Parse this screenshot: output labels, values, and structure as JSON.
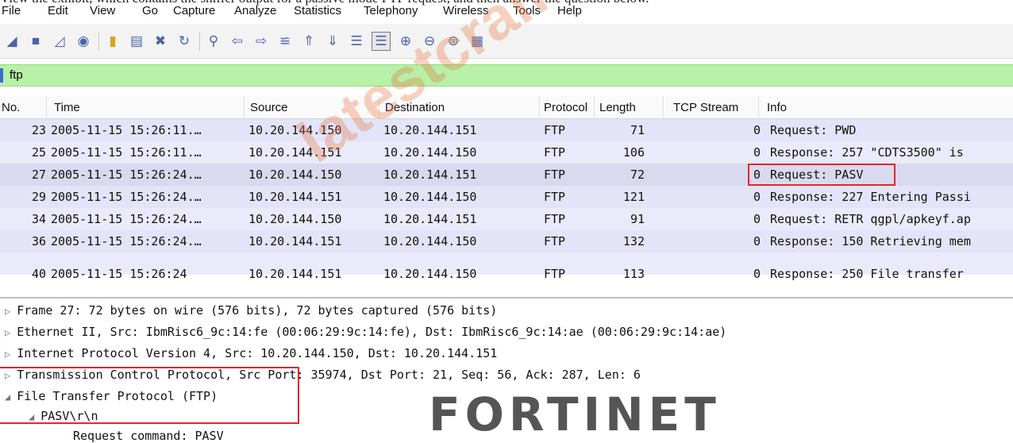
{
  "caption": "View the exhibit, which contains the sniffer output for a passive mode FTP request, and then answer the question below.",
  "menu": [
    "File",
    "Edit",
    "View",
    "Go",
    "Capture",
    "Analyze",
    "Statistics",
    "Telephony",
    "Wireless",
    "Tools",
    "Help"
  ],
  "toolbar_icons": [
    "shark-fin-start-icon",
    "stop-icon",
    "restart-icon",
    "options-gear-icon",
    "open-folder-icon",
    "save-file-icon",
    "close-file-icon",
    "reload-icon",
    "find-packet-icon",
    "go-back-icon",
    "go-forward-icon",
    "go-to-packet-icon",
    "first-packet-icon",
    "last-packet-icon",
    "autoscroll-icon",
    "colorize-icon",
    "zoom-in-icon",
    "zoom-out-icon",
    "normal-size-icon",
    "resize-columns-icon"
  ],
  "filter": {
    "value": "ftp"
  },
  "columns": [
    "No.",
    "Time",
    "Source",
    "Destination",
    "Protocol",
    "Length",
    "TCP Stream",
    "Info"
  ],
  "rows": [
    {
      "no": "23",
      "time": "2005-11-15 15:26:11.…",
      "src": "10.20.144.150",
      "dst": "10.20.144.151",
      "proto": "FTP",
      "len": "71",
      "stream": "0",
      "info": "Request: PWD"
    },
    {
      "no": "25",
      "time": "2005-11-15 15:26:11.…",
      "src": "10.20.144.151",
      "dst": "10.20.144.150",
      "proto": "FTP",
      "len": "106",
      "stream": "0",
      "info": "Response: 257 \"CDTS3500\" is"
    },
    {
      "no": "27",
      "time": "2005-11-15 15:26:24.…",
      "src": "10.20.144.150",
      "dst": "10.20.144.151",
      "proto": "FTP",
      "len": "72",
      "stream": "0",
      "info": "Request: PASV"
    },
    {
      "no": "29",
      "time": "2005-11-15 15:26:24.…",
      "src": "10.20.144.151",
      "dst": "10.20.144.150",
      "proto": "FTP",
      "len": "121",
      "stream": "0",
      "info": "Response: 227 Entering Passi"
    },
    {
      "no": "34",
      "time": "2005-11-15 15:26:24.…",
      "src": "10.20.144.150",
      "dst": "10.20.144.151",
      "proto": "FTP",
      "len": "91",
      "stream": "0",
      "info": "Request: RETR qgpl/apkeyf.ap"
    },
    {
      "no": "36",
      "time": "2005-11-15 15:26:24.…",
      "src": "10.20.144.151",
      "dst": "10.20.144.150",
      "proto": "FTP",
      "len": "132",
      "stream": "0",
      "info": "Response: 150 Retrieving mem"
    },
    {
      "no": "40",
      "time": "2005-11-15 15:26:24",
      "src": "10.20.144.151",
      "dst": "10.20.144.150",
      "proto": "FTP",
      "len": "113",
      "stream": "0",
      "info": "Response: 250 File transfer"
    }
  ],
  "details": [
    "Frame 27: 72 bytes on wire (576 bits), 72 bytes captured (576 bits)",
    "Ethernet II, Src: IbmRisc6_9c:14:fe (00:06:29:9c:14:fe), Dst: IbmRisc6_9c:14:ae (00:06:29:9c:14:ae)",
    "Internet Protocol Version 4, Src: 10.20.144.150, Dst: 10.20.144.151",
    "Transmission Control Protocol, Src Port: 35974, Dst Port: 21, Seq: 56, Ack: 287, Len: 6",
    "File Transfer Protocol (FTP)",
    "PASV\\r\\n",
    "Request command: PASV"
  ],
  "watermark": "latestcram.com",
  "logo": "FORTINET",
  "colors": {
    "filter_bg": "#b7f0a6",
    "row_bg": "#e4e4f8",
    "highlight": "#e0282c"
  }
}
